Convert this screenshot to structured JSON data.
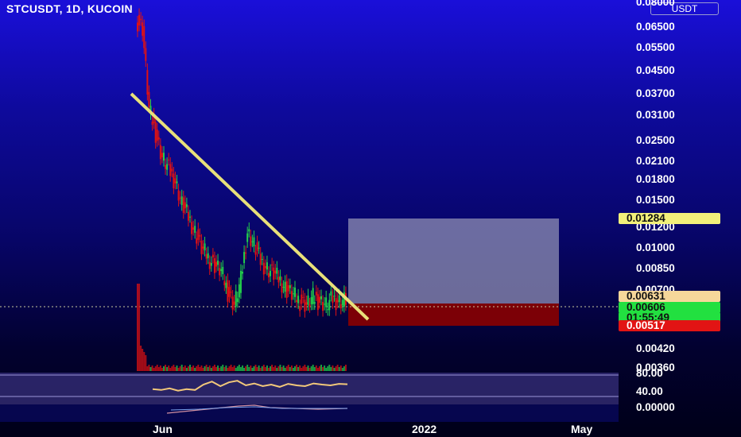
{
  "symbol_title": "STCUSDT, 1D, KUCOIN",
  "currency": "USDT",
  "colors": {
    "up": "#22d04a",
    "down": "#e01212",
    "trendline": "#e8e07a",
    "target_zone": "#8f8fb4",
    "stop_zone": "#8a0000",
    "rsi_line": "#f2c87a"
  },
  "price_axis_ticks": [
    "0.08000",
    "0.06500",
    "0.05500",
    "0.04500",
    "0.03700",
    "0.03100",
    "0.02500",
    "0.02100",
    "0.01800",
    "0.01500",
    "0.01200",
    "0.01000",
    "0.00850",
    "0.00700",
    "0.00420",
    "0.00360"
  ],
  "badges": {
    "target": "0.01284",
    "entry": "0.00631",
    "last_price": "0.00606",
    "countdown": "01:55:49",
    "stop": "0.00517"
  },
  "rsi_axis": {
    "top_label": "80.00",
    "mid_label": "40.00"
  },
  "macd_axis": {
    "label": "0.00000"
  },
  "x_axis_labels": [
    "Jun",
    "2022",
    "May"
  ],
  "chart_data": {
    "type": "candlestick",
    "title": "STCUSDT, 1D, KUCOIN",
    "y_scale": "log",
    "ylim": [
      0.0033,
      0.08
    ],
    "x_axis_labels": [
      "Jun",
      "2022",
      "May"
    ],
    "close_estimates": [
      0.065,
      0.032,
      0.026,
      0.021,
      0.019,
      0.017,
      0.014,
      0.0125,
      0.011,
      0.0095,
      0.0088,
      0.0082,
      0.0078,
      0.0065,
      0.0058,
      0.0072,
      0.011,
      0.0098,
      0.0085,
      0.008,
      0.0076,
      0.0072,
      0.0066,
      0.0063,
      0.006,
      0.0058,
      0.0062,
      0.006,
      0.0058,
      0.0061,
      0.006,
      0.0061
    ],
    "trendline": {
      "start_price": 0.037,
      "end_price": 0.0058
    },
    "position_tool": {
      "target_price": 0.01284,
      "entry_price": 0.00631,
      "stop_price": 0.00517
    },
    "last_price": 0.00606,
    "rsi": {
      "levels": [
        80,
        40
      ],
      "values": [
        40,
        38,
        42,
        36,
        40,
        38,
        52,
        60,
        48,
        58,
        62,
        50,
        55,
        48,
        52,
        46,
        54,
        50,
        48,
        55,
        52,
        50,
        54,
        53
      ]
    },
    "macd_zero_label": "0.00000"
  }
}
